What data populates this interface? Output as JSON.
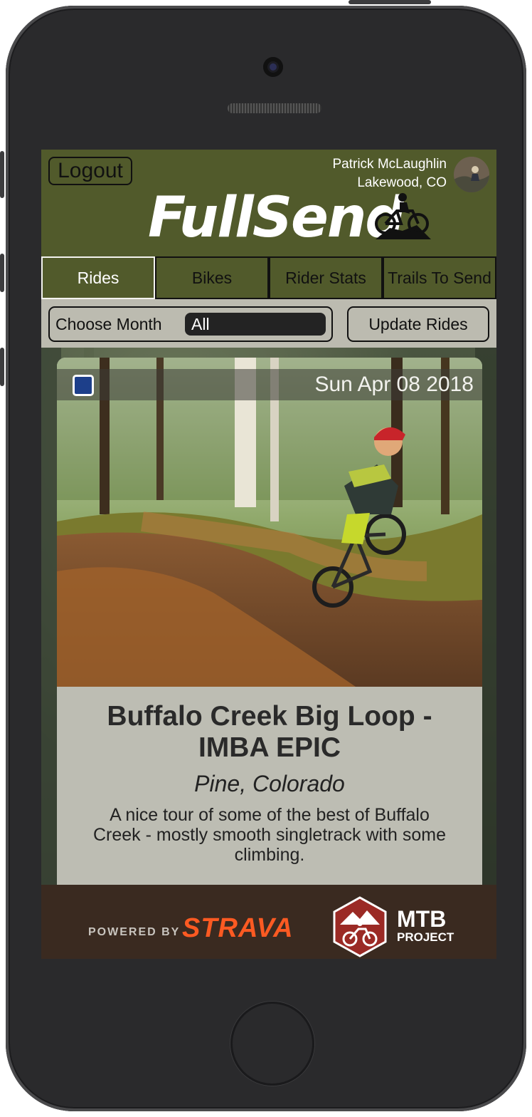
{
  "header": {
    "logout_label": "Logout",
    "user_name": "Patrick McLaughlin",
    "user_location": "Lakewood, CO",
    "logo_text": "FullSend"
  },
  "tabs": [
    {
      "label": "Rides",
      "active": true
    },
    {
      "label": "Bikes",
      "active": false
    },
    {
      "label": "Rider Stats",
      "active": false
    },
    {
      "label": "Trails To Send",
      "active": false
    }
  ],
  "controls": {
    "month_label": "Choose Month",
    "month_selected": "All",
    "update_label": "Update Rides"
  },
  "ride_card": {
    "date": "Sun Apr 08 2018",
    "checked": false,
    "title": "Buffalo Creek Big Loop - IMBA EPIC",
    "location": "Pine, Colorado",
    "description": "A nice tour of some of the best of Buffalo Creek - mostly smooth singletrack with some climbing."
  },
  "footer": {
    "powered_by": "POWERED BY",
    "strava": "STRAVA",
    "mtb_line1": "MTB",
    "mtb_line2": "PROJECT"
  },
  "colors": {
    "header_olive": "#515a2b",
    "controls_bg": "#bcbbb0",
    "footer_brown": "#3a2a20",
    "strava_orange": "#fc5a22",
    "mtb_red": "#9b2a25"
  }
}
